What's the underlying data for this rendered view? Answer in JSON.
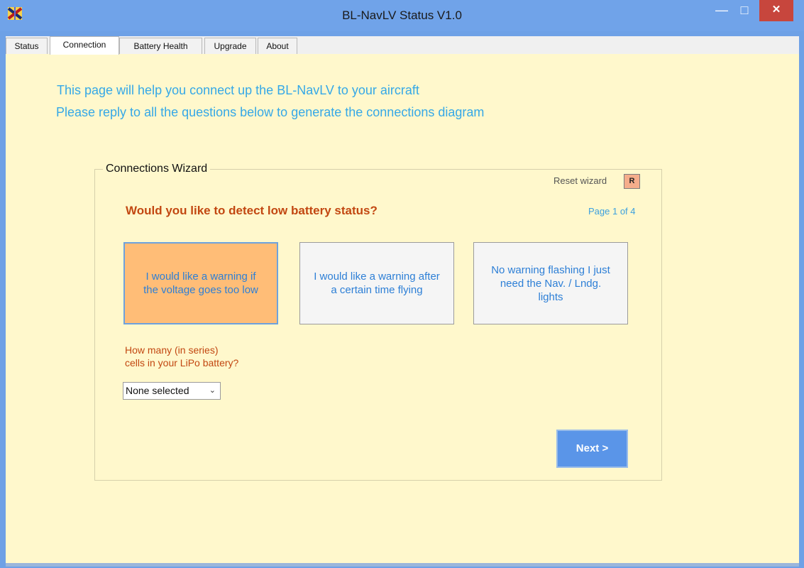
{
  "window": {
    "title": "BL-NavLV Status V1.0",
    "controls": {
      "minimize": "—",
      "maximize": "□",
      "close": "✕"
    }
  },
  "tabs": [
    {
      "label": "Status",
      "active": false
    },
    {
      "label": "Connection",
      "active": true
    },
    {
      "label": "Battery Health",
      "active": false
    },
    {
      "label": "Upgrade",
      "active": false
    },
    {
      "label": "About",
      "active": false
    }
  ],
  "intro": {
    "line1": "This page will help you connect up the BL-NavLV to your aircraft",
    "line2": "Please reply to all the questions below to generate the connections diagram"
  },
  "wizard": {
    "legend": "Connections Wizard",
    "reset_label": "Reset wizard",
    "reset_button": "R",
    "question": "Would you like to detect low battery status?",
    "page": "Page 1 of 4",
    "options": [
      {
        "text": "I would like a warning if the voltage goes too low",
        "selected": true
      },
      {
        "text": "I would like a warning after a certain time flying",
        "selected": false
      },
      {
        "text": "No warning flashing I just need the Nav. / Lndg. lights",
        "selected": false
      }
    ],
    "cells_label_line1": "How many (in series)",
    "cells_label_line2": "cells in your LiPo battery?",
    "cells_select_value": "None selected",
    "next_button": "Next >"
  },
  "colors": {
    "accent": "#35a8e7",
    "question": "#c24711",
    "selected_option": "#ffbd77",
    "background": "#fff8cc",
    "next": "#5a95e8"
  }
}
